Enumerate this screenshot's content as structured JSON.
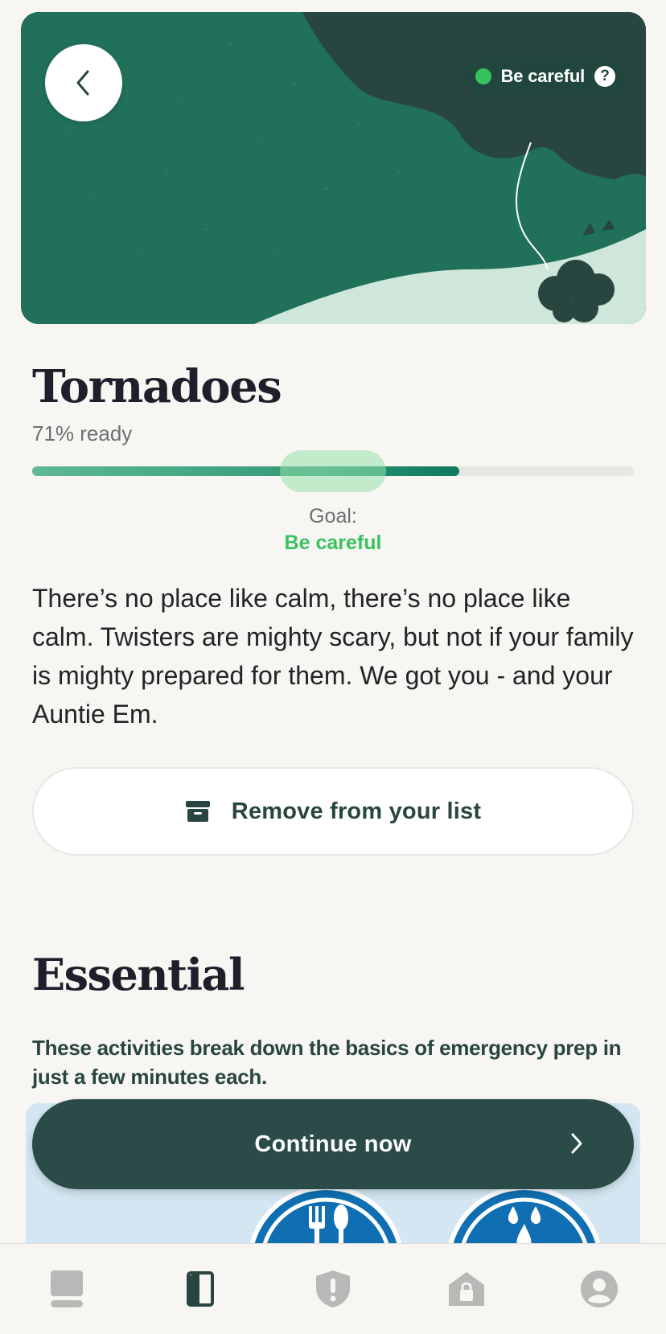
{
  "hero": {
    "status_label": "Be careful",
    "help_glyph": "?",
    "icons": {
      "back": "chevron-left-icon",
      "help": "question-circle-icon"
    },
    "colors": {
      "background": "#20705a",
      "cloud": "#28463f",
      "ground": "#cfe7db",
      "status_dot": "#35c25e"
    }
  },
  "topic": {
    "title": "Tornadoes",
    "ready_text": "71% ready",
    "progress_fraction": 0.71,
    "goal_label": "Goal:",
    "goal_value": "Be careful",
    "description": "There’s no place like calm, there’s no place like calm. Twisters are mighty scary, but not if your family is mighty prepared for them. We got you - and your Auntie Em.",
    "remove_label": "Remove from your list",
    "remove_icon": "archive-box-icon"
  },
  "essential": {
    "title": "Essential",
    "subtitle": "These activities break down the basics of emergency prep in just a few minutes each.",
    "card_icons": [
      "fork-knife-icon",
      "water-drops-icon"
    ]
  },
  "continue": {
    "label": "Continue now",
    "icon": "chevron-right-icon"
  },
  "tabbar": {
    "tabs": [
      {
        "icon": "feed-icon",
        "active": false
      },
      {
        "icon": "book-icon",
        "active": true
      },
      {
        "icon": "shield-alert-icon",
        "active": false
      },
      {
        "icon": "home-lock-icon",
        "active": false
      },
      {
        "icon": "profile-icon",
        "active": false
      }
    ],
    "colors": {
      "active": "#28463f",
      "inactive": "#b8b8b6"
    }
  }
}
